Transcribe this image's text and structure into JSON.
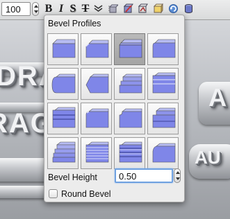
{
  "toolbar": {
    "font_size_value": "100",
    "bold_label": "B",
    "italic_label": "I",
    "shadow_label": "S",
    "strike_label": "T"
  },
  "popup": {
    "title": "Bevel Profiles",
    "selected_profile": 3,
    "bevel_height_label": "Bevel Height",
    "bevel_height_value": "0.50",
    "round_bevel_label": "Round Bevel",
    "round_bevel_checked": false
  },
  "scene": {
    "text_1": "DRA",
    "text_2": "RAG",
    "text_3": "A",
    "text_4": "AU"
  },
  "colors": {
    "bevel_face": "#7f86e8",
    "bevel_side": "#5a60b8",
    "bevel_top": "#b7bcf2",
    "focus_ring": "#6fa1e0"
  }
}
